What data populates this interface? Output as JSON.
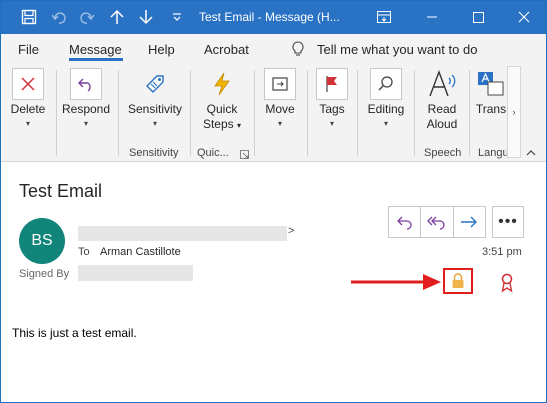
{
  "window": {
    "title": "Test Email  -  Message (H...",
    "colors": {
      "titlebar": "#2a73c4",
      "accent": "#2a73c4",
      "arrow": "#e11d1d"
    }
  },
  "quick_access": [
    "save-icon",
    "undo-icon",
    "redo-icon",
    "up-arrow-icon",
    "down-arrow-icon",
    "customize-icon"
  ],
  "tabs": [
    {
      "label": "File"
    },
    {
      "label": "Message"
    },
    {
      "label": "Help"
    },
    {
      "label": "Acrobat"
    }
  ],
  "tell_me": "Tell me what you want to do",
  "ribbon": {
    "delete": {
      "label": "Delete",
      "icon": "delete-x-icon"
    },
    "respond": {
      "label": "Respond",
      "icon": "reply-arrow-icon"
    },
    "sensitivity_btn": {
      "label": "Sensitivity",
      "icon": "sensitivity-tag-icon"
    },
    "quick_steps": {
      "label1": "Quick",
      "label2": "Steps",
      "icon": "lightning-icon"
    },
    "move": {
      "label": "Move",
      "icon": "move-folder-icon"
    },
    "tags": {
      "label": "Tags",
      "icon": "flag-icon"
    },
    "editing": {
      "label": "Editing",
      "icon": "search-magnifier-icon"
    },
    "read_aloud": {
      "label1": "Read",
      "label2": "Aloud",
      "icon": "read-aloud-icon"
    },
    "translate": {
      "label": "Trans",
      "icon": "translate-icon"
    },
    "groups": {
      "sensitivity": "Sensitivity",
      "quick": "Quic...",
      "speech": "Speech",
      "language": "Langu..."
    }
  },
  "message": {
    "subject": "Test Email",
    "avatar_initials": "BS",
    "to_label": "To",
    "to_name": "Arman Castillote",
    "signed_by_label": "Signed By",
    "time": "3:51 pm",
    "sender_trailing": ">",
    "body": "This is just a test email."
  }
}
